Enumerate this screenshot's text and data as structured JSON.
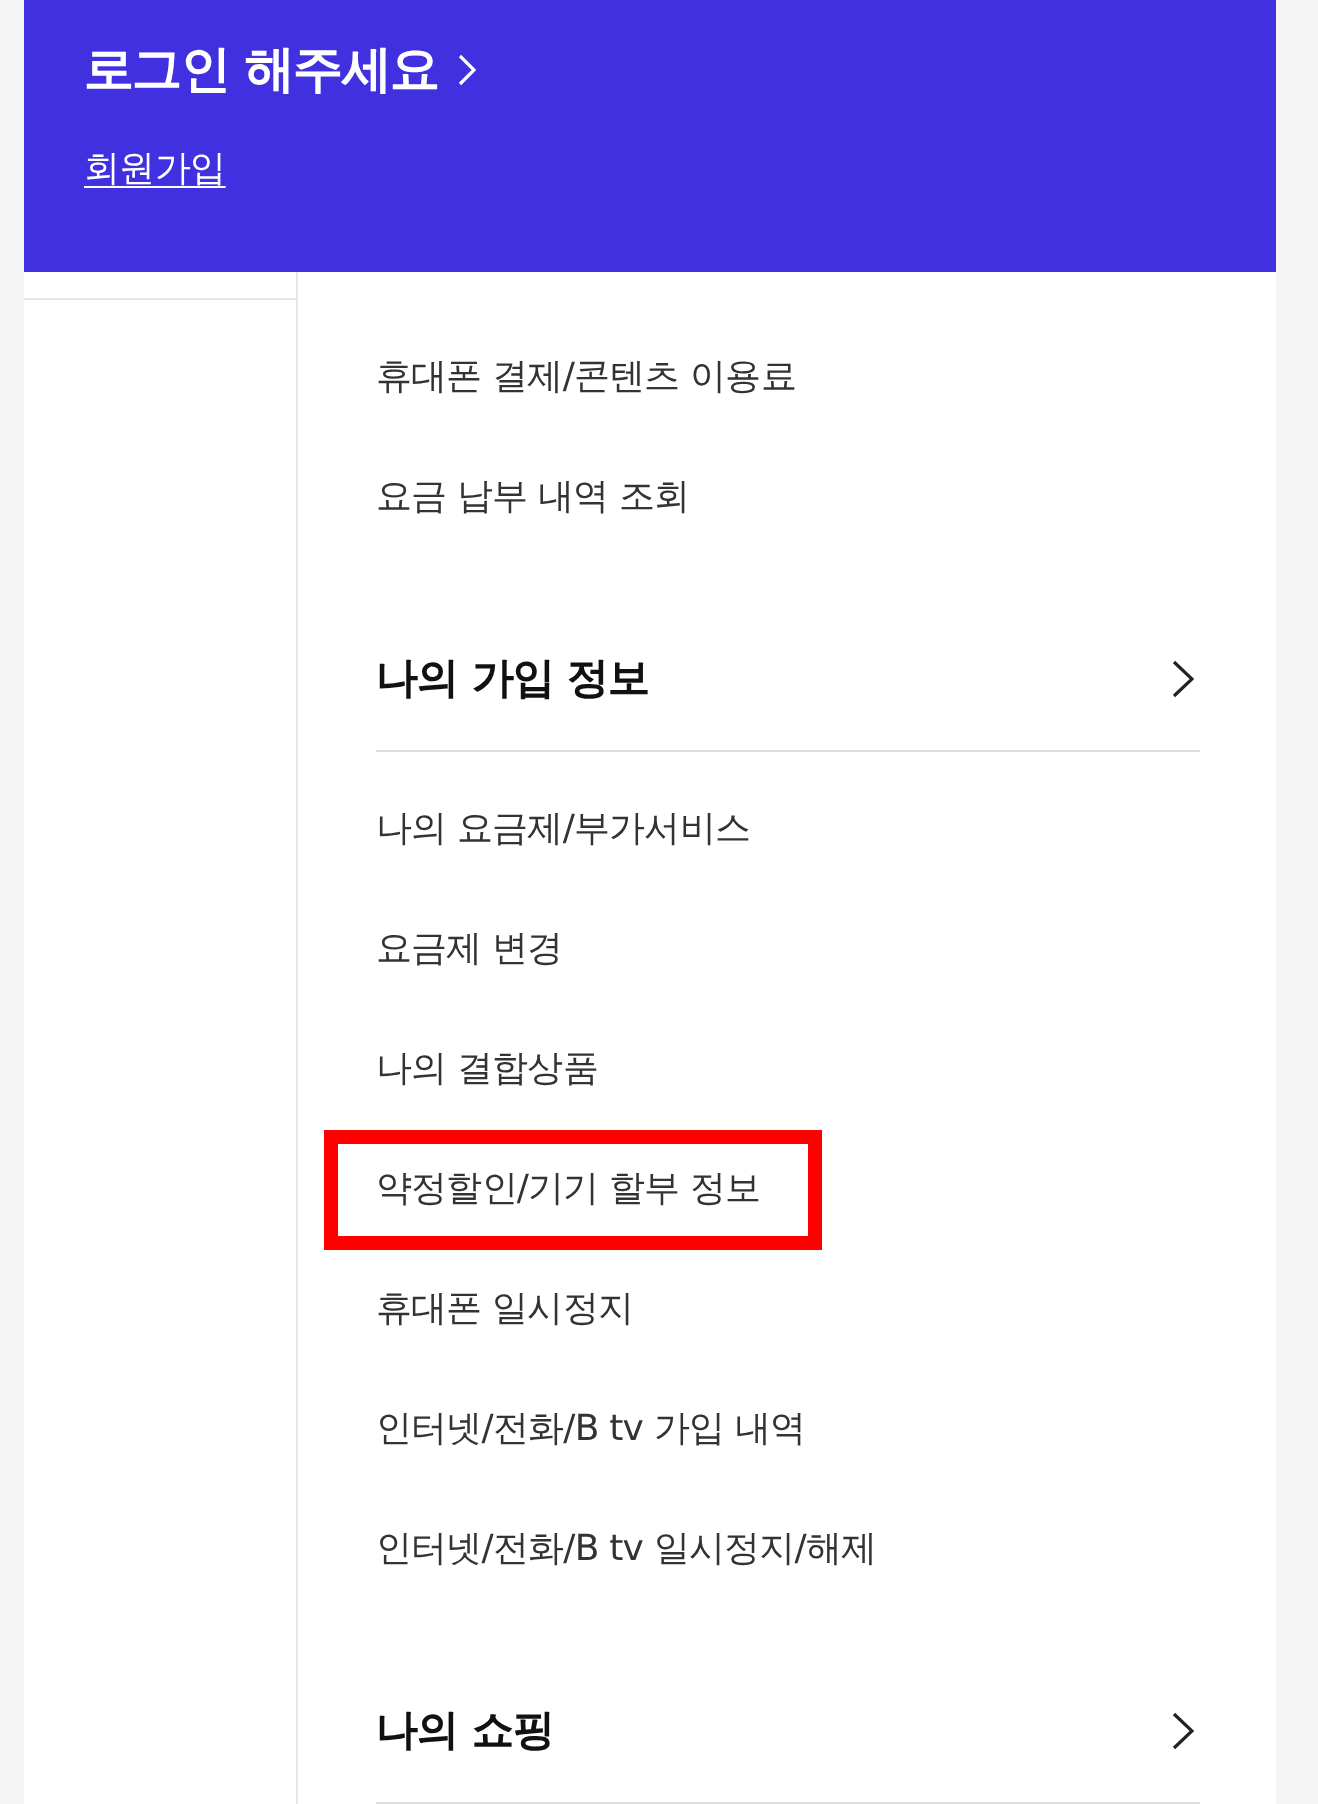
{
  "header": {
    "title": "로그인 해주세요",
    "signup_link": "회원가입"
  },
  "menu": [
    {
      "items": [
        {
          "label": "휴대폰 결제/콘텐츠 이용료",
          "highlighted": false
        },
        {
          "label": "요금 납부 내역 조회",
          "highlighted": false
        }
      ]
    },
    {
      "title": "나의 가입 정보",
      "items": [
        {
          "label": "나의 요금제/부가서비스",
          "highlighted": false
        },
        {
          "label": "요금제 변경",
          "highlighted": false
        },
        {
          "label": "나의 결합상품",
          "highlighted": false
        },
        {
          "label": "약정할인/기기 할부 정보",
          "highlighted": true
        },
        {
          "label": "휴대폰 일시정지",
          "highlighted": false
        },
        {
          "label": "인터넷/전화/B tv 가입 내역",
          "highlighted": false
        },
        {
          "label": "인터넷/전화/B tv 일시정지/해제",
          "highlighted": false
        }
      ]
    },
    {
      "title": "나의 쇼핑"
    }
  ]
}
